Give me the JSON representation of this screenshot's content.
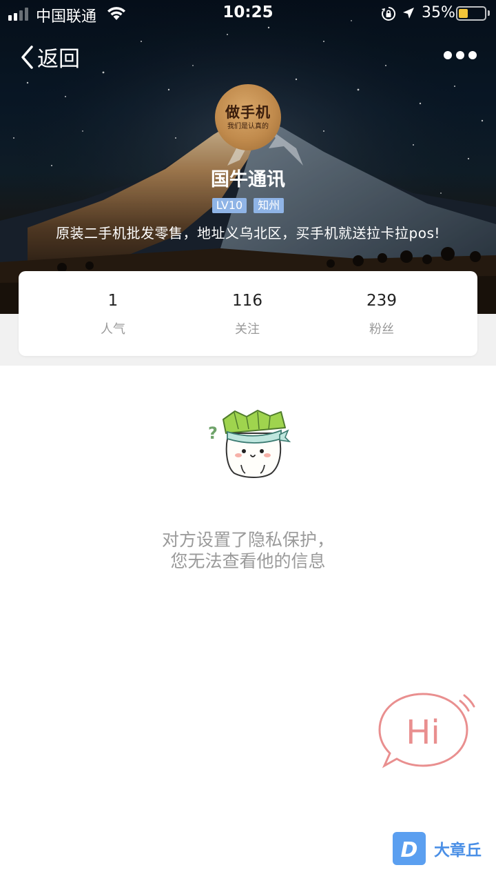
{
  "status_bar": {
    "carrier": "中国联通",
    "time": "10:25",
    "battery_percent": "35%",
    "battery_level": 0.35,
    "battery_color": "#f4c63a"
  },
  "nav": {
    "back_label": "返回",
    "back_icon": "chevron-left-icon",
    "more_icon": "more-dots-icon"
  },
  "profile": {
    "avatar_title": "做手机",
    "avatar_subtitle": "我们是认真的",
    "name": "国牛通讯",
    "badges": [
      "LV10",
      "知州"
    ],
    "bio": "原装二手机批发零售，地址义乌北区，买手机就送拉卡拉pos!"
  },
  "stats": [
    {
      "value": "1",
      "label": "人气"
    },
    {
      "value": "116",
      "label": "关注"
    },
    {
      "value": "239",
      "label": "粉丝"
    }
  ],
  "empty_state": {
    "line1": "对方设置了隐私保护，",
    "line2": "您无法查看他的信息"
  },
  "chat_bubble": {
    "text": "Hi",
    "color": "#e98f8f"
  },
  "watermark": {
    "logo_letter": "D",
    "text": "大章丘"
  },
  "colors": {
    "badge": "#8fb4e6",
    "muted_text": "#9a9a9a",
    "band": "#f1f1f1"
  }
}
